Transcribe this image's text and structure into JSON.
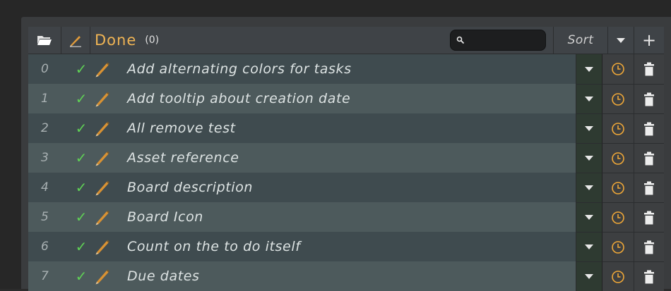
{
  "header": {
    "title": "Done",
    "count": "(0)",
    "search_value": "",
    "sort_label": "Sort",
    "add_label": "+"
  },
  "tasks": [
    {
      "index": "0",
      "text": "Add alternating colors for tasks"
    },
    {
      "index": "1",
      "text": "Add tooltip about creation date"
    },
    {
      "index": "2",
      "text": "All remove test"
    },
    {
      "index": "3",
      "text": "Asset reference"
    },
    {
      "index": "4",
      "text": "Board description"
    },
    {
      "index": "5",
      "text": "Board Icon"
    },
    {
      "index": "6",
      "text": "Count on the to do itself"
    },
    {
      "index": "7",
      "text": "Due dates"
    }
  ],
  "colors": {
    "title_accent": "#f0b454",
    "check": "#5fcf55",
    "clock": "#f0a838",
    "pencil": "#e0a040"
  }
}
